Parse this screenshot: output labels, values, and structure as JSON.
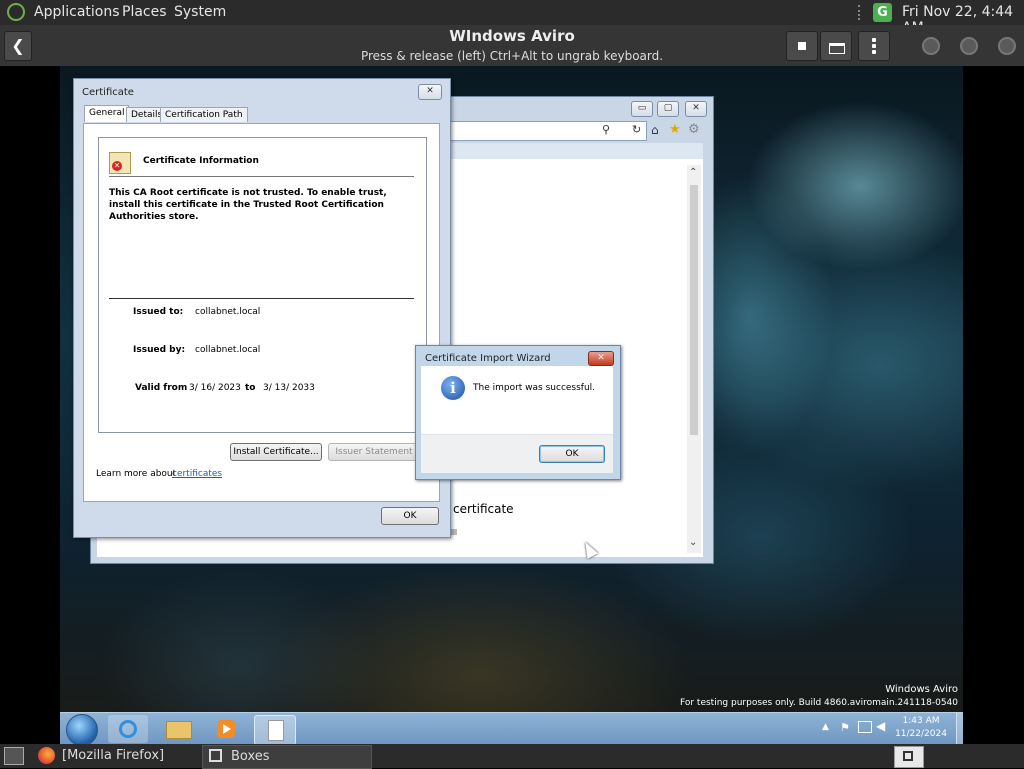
{
  "top_panel": {
    "menus": [
      "Applications",
      "Places",
      "System"
    ],
    "clock": "Fri Nov 22,  4:44 AM"
  },
  "boxes_header": {
    "title": "WIndows Aviro",
    "subtitle": "Press & release (left) Ctrl+Alt to ungrab keyboard."
  },
  "certificate_dialog": {
    "title": "Certificate",
    "tabs": [
      "General",
      "Details",
      "Certification Path"
    ],
    "info_heading": "Certificate Information",
    "warning": "This CA Root certificate is not trusted. To enable trust, install this certificate in the Trusted Root Certification Authorities store.",
    "issued_to_label": "Issued to:",
    "issued_to": "collabnet.local",
    "issued_by_label": "Issued by:",
    "issued_by": "collabnet.local",
    "valid_from_label": "Valid from",
    "valid_from": "3/ 16/ 2023",
    "to_label": "to",
    "valid_to": "3/ 13/ 2033",
    "install_button": "Install Certificate...",
    "issuer_button": "Issuer Statement",
    "learn_more": "Learn more about",
    "learn_more_link": "certificates",
    "ok_button": "OK"
  },
  "browser": {
    "visible_text": "certificate"
  },
  "import_wizard": {
    "title": "Certificate Import Wizard",
    "message": "The import was successful.",
    "ok_button": "OK"
  },
  "watermark": {
    "line1": "Windows Aviro",
    "line2": "For testing purposes only. Build 4860.aviromain.241118-0540"
  },
  "win_taskbar": {
    "time": "1:43 AM",
    "date": "11/22/2024"
  },
  "bottom_panel": {
    "tasks": [
      "[Mozilla Firefox]",
      "Boxes"
    ]
  }
}
